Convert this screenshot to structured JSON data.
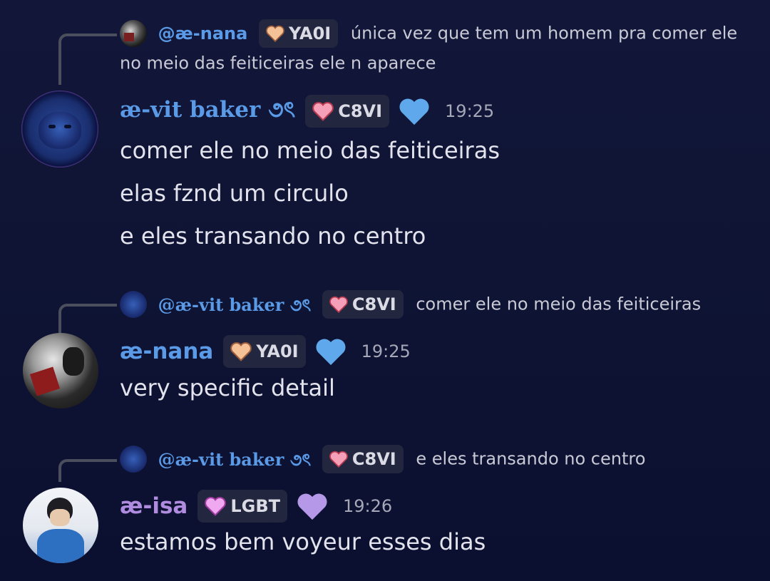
{
  "colors": {
    "background": "#10153a",
    "username_blue": "#5a9ae6",
    "username_purple": "#b08ce0",
    "tag_bg": "#23263f",
    "heart_blue": "#5fa8ec",
    "heart_purple": "#b599e8",
    "text": "#e2e3ec",
    "timestamp": "#a6a8b8"
  },
  "messages": [
    {
      "reply": {
        "username": "@æ-nana",
        "tag": "YA0I",
        "tag_heart": "peach-heart-icon",
        "text": "única vez que tem um homem pra comer ele no meio das feiticeiras ele n aparece"
      },
      "username": "æ-vit baker ૭ৎ",
      "tag": "C8VI",
      "tag_heart": "pink-heart-icon",
      "status_heart": "blue-heart-icon",
      "time": "19:25",
      "lines": [
        "comer ele no meio das feiticeiras",
        "elas fznd um circulo",
        "e eles transando no centro"
      ]
    },
    {
      "reply": {
        "username": "@æ-vit baker ૭ৎ",
        "tag": "C8VI",
        "tag_heart": "pink-heart-icon",
        "text": "comer ele no meio das feiticeiras"
      },
      "username": "æ-nana",
      "tag": "YA0I",
      "tag_heart": "peach-heart-icon",
      "status_heart": "blue-heart-icon",
      "time": "19:25",
      "lines": [
        "very specific detail"
      ]
    },
    {
      "reply": {
        "username": "@æ-vit baker ૭ৎ",
        "tag": "C8VI",
        "tag_heart": "pink-heart-icon",
        "text": "e eles transando no centro"
      },
      "username": "æ-isa",
      "tag": "LGBT",
      "tag_heart": "magenta-heart-icon",
      "status_heart": "purple-heart-icon",
      "time": "19:26",
      "lines": [
        "estamos bem voyeur esses dias"
      ]
    }
  ]
}
